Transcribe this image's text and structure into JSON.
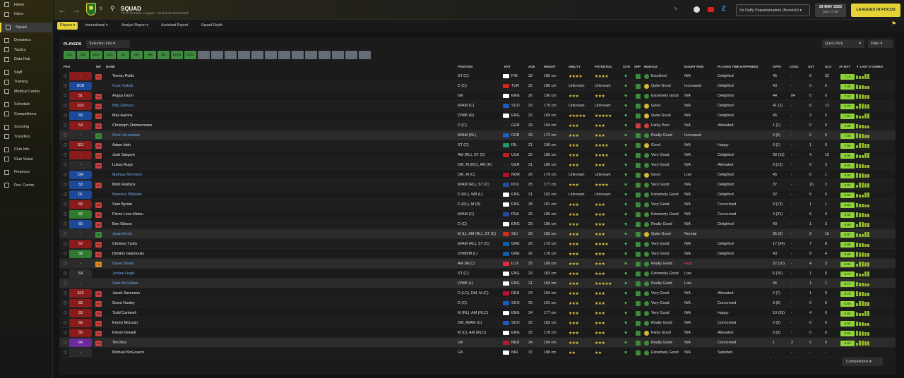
{
  "sidebar": {
    "items": [
      {
        "label": "Home",
        "icon": "home-icon"
      },
      {
        "label": "Inbox",
        "icon": "inbox-icon"
      },
      {
        "label": "Squad",
        "icon": "squad-icon"
      },
      {
        "label": "Dynamics",
        "icon": "dynamics-icon"
      },
      {
        "label": "Tactics",
        "icon": "tactics-icon"
      },
      {
        "label": "Data Hub",
        "icon": "datahub-icon"
      },
      {
        "label": "Staff",
        "icon": "staff-icon"
      },
      {
        "label": "Training",
        "icon": "training-icon"
      },
      {
        "label": "Medical Centre",
        "icon": "medical-icon"
      },
      {
        "label": "Schedule",
        "icon": "schedule-icon"
      },
      {
        "label": "Competitions",
        "icon": "trophy-icon"
      },
      {
        "label": "Scouting",
        "icon": "scouting-icon"
      },
      {
        "label": "Transfers",
        "icon": "transfers-icon"
      },
      {
        "label": "Club Info",
        "icon": "club-info-icon"
      },
      {
        "label": "Club Vision",
        "icon": "club-vision-icon"
      },
      {
        "label": "Finances",
        "icon": "finances-icon"
      },
      {
        "label": "Dev. Centre",
        "icon": "dev-centre-icon"
      }
    ]
  },
  "header": {
    "title": "SQUAD",
    "subtitle": "7th in Premier League - No fixture scheduled.",
    "manager": "Sir Daffy Papastamatinio (Norwich)",
    "date": "29 MAY 2022",
    "day": "Sun 17:00",
    "leagues_btn": "LEAGUES IN FOCUS"
  },
  "subnav": [
    "Players",
    "International",
    "Analyst Report",
    "Assistant Report",
    "Squad Depth"
  ],
  "panel": {
    "title": "PLAYERS",
    "selection_info": "Selection Info",
    "quick_pick": "Quick Pick",
    "filter": "Filter",
    "competitions": "Competitions"
  },
  "positions": [
    "GK",
    "DR",
    "DCR",
    "DCL",
    "DL",
    "DM",
    "MR",
    "ML",
    "STCR",
    "STCL",
    "",
    "",
    "",
    "",
    "",
    "",
    "",
    "",
    "",
    "",
    "",
    "",
    ""
  ],
  "columns": {
    "pkd": "PKD",
    "inf": "INF",
    "name": "NAME",
    "position": "POSITION",
    "nat": "NAT",
    "age": "AGE",
    "height": "HEIGHT",
    "ability": "ABILITY",
    "potential": "POTENTIAL",
    "con": "CON",
    "shp": "SHP",
    "morale": "MORALE",
    "injury": "INJURY RISK",
    "pt": "PLAYING TIME HAPPINESS",
    "apps": "APPS",
    "conc": "CONC",
    "ast": "AST",
    "gls": "GLS",
    "avrat": "AV RAT",
    "last5": "▼ LAST 5 GAMES"
  },
  "players": [
    {
      "pick": "-",
      "pickcolor": "#8a1b1b",
      "name": "Teemu Pukki",
      "pos": "ST (C)",
      "nat": "FIN",
      "age": "32",
      "ht": "180 cm",
      "ab": "★★★★",
      "pot": "★★★★",
      "morale": "Excellent",
      "inj": "N/A",
      "pt": "Delighted",
      "apps": "45",
      "conc": "-",
      "ast": "6",
      "gls": "32",
      "rat": "7.15",
      "inf": "Hot",
      "infc": "#c94040",
      "link": false,
      "flag": "#fff"
    },
    {
      "pick": "DCR",
      "pickcolor": "#1c4a9a",
      "name": "Ozan Kabak",
      "pos": "D (C)",
      "nat": "TUR",
      "age": "22",
      "ht": "186 cm",
      "ab": "Unknown",
      "pot": "Unknown",
      "morale": "Quite Good",
      "inj": "Increased",
      "pt": "Delighted",
      "apps": "43",
      "conc": "-",
      "ast": "0",
      "gls": "5",
      "rat": "7.08",
      "inf": "",
      "infc": "",
      "link": true,
      "flag": "#d22"
    },
    {
      "pick": "S1",
      "pickcolor": "#8a1b1b",
      "name": "Angus Gunn",
      "pos": "GK",
      "nat": "ENG",
      "age": "26",
      "ht": "196 cm",
      "ab": "★★★",
      "pot": "★★★",
      "morale": "Extremely Good",
      "inj": "N/A",
      "pt": "Delighted",
      "apps": "44",
      "conc": "84",
      "ast": "0",
      "gls": "0",
      "rat": "7.03",
      "inf": "Hot",
      "infc": "#c94040",
      "link": false,
      "flag": "#fff"
    },
    {
      "pick": "S10",
      "pickcolor": "#8a1b1b",
      "name": "Billy Gilmour",
      "pos": "M/AM (C)",
      "nat": "SCO",
      "age": "20",
      "ht": "170 cm",
      "ab": "Unknown",
      "pot": "Unknown",
      "morale": "Good",
      "inj": "N/A",
      "pt": "Delighted",
      "apps": "41 (2)",
      "conc": "-",
      "ast": "6",
      "gls": "12",
      "rat": "6.70",
      "inf": "Hot",
      "infc": "#c94040",
      "link": true,
      "flag": "#1d5bbf"
    },
    {
      "pick": "S9",
      "pickcolor": "#1c4a9a",
      "name": "Max Aarons",
      "pos": "D/WB (R)",
      "nat": "ENG",
      "age": "22",
      "ht": "169 cm",
      "ab": "★★★★★",
      "pot": "★★★★★",
      "morale": "Quite Good",
      "inj": "N/A",
      "pt": "Delighted",
      "apps": "45",
      "conc": "-",
      "ast": "3",
      "gls": "0",
      "rat": "7.01",
      "inf": "Hot",
      "infc": "#c94040",
      "link": false,
      "flag": "#fff"
    },
    {
      "pick": "S4",
      "pickcolor": "#8a1b1b",
      "name": "Christoph Zimmermann",
      "pos": "D (C)",
      "nat": "GER",
      "age": "29",
      "ht": "194 cm",
      "ab": "★★★",
      "pot": "★★★",
      "morale": "Fairly Poor",
      "inj": "N/A",
      "pt": "Alienated",
      "apps": "1 (1)",
      "conc": "-",
      "ast": "0",
      "gls": "0",
      "rat": "6.98",
      "inf": "Hot",
      "infc": "#c94040",
      "link": false,
      "flag": "#222"
    },
    {
      "pick": "-",
      "pickcolor": "#2b2b2b",
      "name": "Onel Hernández",
      "pos": "M/AM (RL)",
      "nat": "CUB",
      "age": "29",
      "ht": "172 cm",
      "ab": "★★★",
      "pot": "★★★",
      "morale": "Really Good",
      "inj": "Increased",
      "pt": "",
      "apps": "0 (5)",
      "conc": "-",
      "ast": "0",
      "gls": "0",
      "rat": "7.00",
      "inf": "Inj",
      "infc": "#3d8b3d",
      "link": true,
      "flag": "#1d5bbf"
    },
    {
      "pick": "S11",
      "pickcolor": "#8a1b1b",
      "name": "Adam Idah",
      "pos": "ST (C)",
      "nat": "IRL",
      "age": "21",
      "ht": "190 cm",
      "ab": "★★★",
      "pot": "★★★★",
      "morale": "Good",
      "inj": "N/A",
      "pt": "Happy",
      "apps": "0 (1)",
      "conc": "-",
      "ast": "1",
      "gls": "0",
      "rat": "7.00",
      "inf": "Hot",
      "infc": "#c94040",
      "link": false,
      "flag": "#169b62"
    },
    {
      "pick": "-",
      "pickcolor": "#8a1b1b",
      "name": "Josh Sargent",
      "pos": "AM (RL), ST (C)",
      "nat": "USA",
      "age": "22",
      "ht": "185 cm",
      "ab": "★★★",
      "pot": "★★★★",
      "morale": "Very Good",
      "inj": "N/A",
      "pt": "Delighted",
      "apps": "30 (11)",
      "conc": "-",
      "ast": "4",
      "gls": "19",
      "rat": "6.98",
      "inf": "Hot",
      "infc": "#c94040",
      "link": false,
      "flag": "#b22"
    },
    {
      "pick": "-",
      "pickcolor": "#2b2b2b",
      "name": "Lukas Rupp",
      "pos": "DM, M (RC), AM (R)",
      "nat": "GER",
      "age": "31",
      "ht": "180 cm",
      "ab": "★★★",
      "pot": "★★★",
      "morale": "Very Good",
      "inj": "N/A",
      "pt": "Alienated",
      "apps": "0 (13)",
      "conc": "-",
      "ast": "0",
      "gls": "3",
      "rat": "6.92",
      "inf": "Hot",
      "infc": "#c94040",
      "link": false,
      "flag": "#222"
    },
    {
      "pick": "DM",
      "pickcolor": "#1c4a9a",
      "name": "Mathias Normann",
      "pos": "DM, M (C)",
      "nat": "NOR",
      "age": "26",
      "ht": "179 cm",
      "ab": "Unknown",
      "pot": "Unknown",
      "morale": "Good",
      "inj": "Low",
      "pt": "Delighted",
      "apps": "45",
      "conc": "-",
      "ast": "6",
      "gls": "1",
      "rat": "6.92",
      "inf": "",
      "infc": "",
      "link": true,
      "flag": "#ba0c2f"
    },
    {
      "pick": "S3",
      "pickcolor": "#1c4a9a",
      "name": "Milot Rashica",
      "pos": "M/AM (RL), ST (C)",
      "nat": "KVX",
      "age": "25",
      "ht": "177 cm",
      "ab": "★★★",
      "pot": "★★★★",
      "morale": "Very Good",
      "inj": "N/A",
      "pt": "Delighted",
      "apps": "37",
      "conc": "-",
      "ast": "16",
      "gls": "2",
      "rat": "6.92",
      "inf": "Hot",
      "infc": "#c94040",
      "link": false,
      "flag": "#244aa5"
    },
    {
      "pick": "DL",
      "pickcolor": "#1c4a9a",
      "name": "Brandon Williams",
      "pos": "D (RL), WB (L)",
      "nat": "ENG",
      "age": "21",
      "ht": "182 cm",
      "ab": "Unknown",
      "pot": "Unknown",
      "morale": "Extremely Good",
      "inj": "N/A",
      "pt": "Delighted",
      "apps": "32",
      "conc": "-",
      "ast": "5",
      "gls": "0",
      "rat": "6.92",
      "inf": "",
      "infc": "",
      "link": true,
      "flag": "#fff"
    },
    {
      "pick": "S6",
      "pickcolor": "#8a1b1b",
      "name": "Sam Byram",
      "pos": "D (RL), M (R)",
      "nat": "ENG",
      "age": "28",
      "ht": "181 cm",
      "ab": "★★★",
      "pot": "★★★",
      "morale": "Very Good",
      "inj": "N/A",
      "pt": "Concerned",
      "apps": "9 (13)",
      "conc": "-",
      "ast": "1",
      "gls": "1",
      "rat": "6.91",
      "inf": "Hot",
      "infc": "#c94040",
      "link": false,
      "flag": "#fff"
    },
    {
      "pick": "S2",
      "pickcolor": "#2f7a2f",
      "name": "Pierre Lees-Melou",
      "pos": "M/AM (C)",
      "nat": "FRA",
      "age": "29",
      "ht": "185 cm",
      "ab": "★★★",
      "pot": "★★★",
      "morale": "Extremely Good",
      "inj": "N/A",
      "pt": "Concerned",
      "apps": "4 (31)",
      "conc": "-",
      "ast": "6",
      "gls": "0",
      "rat": "6.89",
      "inf": "Hot",
      "infc": "#c94040",
      "link": false,
      "flag": "#244aa5"
    },
    {
      "pick": "S5",
      "pickcolor": "#1c4a9a",
      "name": "Ben Gibson",
      "pos": "D (C)",
      "nat": "ENG",
      "age": "29",
      "ht": "186 cm",
      "ab": "★★★",
      "pot": "★★★",
      "morale": "Really Good",
      "inj": "N/A",
      "pt": "Delighted",
      "apps": "43",
      "conc": "-",
      "ast": "1",
      "gls": "3",
      "rat": "6.89",
      "inf": "Hot",
      "infc": "#c94040",
      "link": false,
      "flag": "#fff"
    },
    {
      "pick": "-",
      "pickcolor": "#2b2b2b",
      "name": "Josip Drmić",
      "pos": "M (L), AM (RL), ST (C)",
      "nat": "SUI",
      "age": "29",
      "ht": "183 cm",
      "ab": "★★★",
      "pot": "★★★",
      "morale": "Quite Good",
      "inj": "Normal",
      "pt": "",
      "apps": "35 (3)",
      "conc": "-",
      "ast": "2",
      "gls": "15",
      "rat": "6.87",
      "inf": "Inj",
      "infc": "#3d8b3d",
      "link": true,
      "flag": "#d52b1e"
    },
    {
      "pick": "S7",
      "pickcolor": "#8a1b1b",
      "name": "Christos Tzolis",
      "pos": "M/AM (RL), ST (C)",
      "nat": "GRE",
      "age": "20",
      "ht": "170 cm",
      "ab": "★★★",
      "pot": "★★★★",
      "morale": "Very Good",
      "inj": "N/A",
      "pt": "Delighted",
      "apps": "17 (24)",
      "conc": "-",
      "ast": "7",
      "gls": "8",
      "rat": "6.86",
      "inf": "Hot",
      "infc": "#c94040",
      "link": false,
      "flag": "#0d5eaf"
    },
    {
      "pick": "S8",
      "pickcolor": "#2f7a2f",
      "name": "Dimitris Giannoulis",
      "pos": "D/WB/M (L)",
      "nat": "GRE",
      "age": "26",
      "ht": "178 cm",
      "ab": "★★★",
      "pot": "★★★",
      "morale": "Very Good",
      "inj": "N/A",
      "pt": "Delighted",
      "apps": "43",
      "conc": "-",
      "ast": "8",
      "gls": "4",
      "rat": "6.86",
      "inf": "Hot",
      "infc": "#c94040",
      "link": false,
      "flag": "#0d5eaf"
    },
    {
      "pick": "-",
      "pickcolor": "#2b2b2b",
      "name": "Danel Sinani",
      "pos": "AM (RLC)",
      "nat": "LUX",
      "age": "25",
      "ht": "189 cm",
      "ab": "★★★",
      "pot": "★★★",
      "morale": "Really Good",
      "inj": "High",
      "pt": "",
      "apps": "22 (10)",
      "conc": "-",
      "ast": "4",
      "gls": "3",
      "rat": "6.86",
      "inf": "Inj",
      "infc": "#e08a2a",
      "link": true,
      "flag": "#ed2939"
    },
    {
      "pick": "S4",
      "pickcolor": "#2b2b2b",
      "name": "Jordan Hugill",
      "pos": "ST (C)",
      "nat": "ENG",
      "age": "29",
      "ht": "183 cm",
      "ab": "★★★",
      "pot": "★★★",
      "morale": "Extremely Good",
      "inj": "Low",
      "pt": "",
      "apps": "6 (26)",
      "conc": "-",
      "ast": "1",
      "gls": "6",
      "rat": "6.77",
      "inf": "",
      "infc": "",
      "link": true,
      "flag": "#fff"
    },
    {
      "pick": "-",
      "pickcolor": "#2b2b2b",
      "name": "Sam McCallum",
      "pos": "D/WB (L)",
      "nat": "ENG",
      "age": "21",
      "ht": "184 cm",
      "ab": "★★★",
      "pot": "★★★★★",
      "morale": "Really Good",
      "inj": "Low",
      "pt": "",
      "apps": "46",
      "conc": "-",
      "ast": "1",
      "gls": "1",
      "rat": "6.77",
      "inf": "",
      "infc": "",
      "link": true,
      "flag": "#fff"
    },
    {
      "pick": "S10",
      "pickcolor": "#8a1b1b",
      "name": "Jacob Sørensen",
      "pos": "D (LC), DM, M (C)",
      "nat": "DEN",
      "age": "24",
      "ht": "184 cm",
      "ab": "★★★",
      "pot": "★★★",
      "morale": "Very Good",
      "inj": "N/A",
      "pt": "Alienated",
      "apps": "2 (7)",
      "conc": "-",
      "ast": "1",
      "gls": "0",
      "rat": "6.76",
      "inf": "Hot",
      "infc": "#c94040",
      "link": false,
      "flag": "#c60c30"
    },
    {
      "pick": "S2",
      "pickcolor": "#8a1b1b",
      "name": "Grant Hanley",
      "pos": "D (C)",
      "nat": "SCO",
      "age": "30",
      "ht": "191 cm",
      "ab": "★★★",
      "pot": "★★★",
      "morale": "Very Good",
      "inj": "N/A",
      "pt": "Concerned",
      "apps": "3 (6)",
      "conc": "-",
      "ast": "0",
      "gls": "0",
      "rat": "6.66",
      "inf": "Hot",
      "infc": "#c94040",
      "link": false,
      "flag": "#1d5bbf"
    },
    {
      "pick": "S3",
      "pickcolor": "#8a1b1b",
      "name": "Todd Cantwell",
      "pos": "M (RL), AM (RLC)",
      "nat": "ENG",
      "age": "24",
      "ht": "177 cm",
      "ab": "★★★",
      "pot": "★★★",
      "morale": "Very Good",
      "inj": "N/A",
      "pt": "Happy",
      "apps": "10 (25)",
      "conc": "-",
      "ast": "4",
      "gls": "0",
      "rat": "6.56",
      "inf": "Hot",
      "infc": "#c94040",
      "link": false,
      "flag": "#fff"
    },
    {
      "pick": "S6",
      "pickcolor": "#8a1b1b",
      "name": "Kenny McLean",
      "pos": "DM, M/AM (C)",
      "nat": "SCO",
      "age": "30",
      "ht": "183 cm",
      "ab": "★★★",
      "pot": "★★★",
      "morale": "Really Good",
      "inj": "N/A",
      "pt": "Concerned",
      "apps": "0 (3)",
      "conc": "-",
      "ast": "0",
      "gls": "0",
      "rat": "6.50",
      "inf": "Hot",
      "infc": "#c94040",
      "link": false,
      "flag": "#1d5bbf"
    },
    {
      "pick": "S5",
      "pickcolor": "#8a1b1b",
      "name": "Kieran Dowell",
      "pos": "M (C), AM (RLC)",
      "nat": "ENG",
      "age": "25",
      "ht": "178 cm",
      "ab": "★★★",
      "pot": "★★★",
      "morale": "Fairly Good",
      "inj": "N/A",
      "pt": "Alienated",
      "apps": "0 (3)",
      "conc": "-",
      "ast": "0",
      "gls": "0",
      "rat": "6.50",
      "inf": "Hot",
      "infc": "#c94040",
      "link": false,
      "flag": "#fff"
    },
    {
      "pick": "GK",
      "pickcolor": "#6b2a9a",
      "name": "Tim Krul",
      "pos": "GK",
      "nat": "NED",
      "age": "34",
      "ht": "194 cm",
      "ab": "★★★",
      "pot": "★★★",
      "morale": "Really Good",
      "inj": "N/A",
      "pt": "Concerned",
      "apps": "1",
      "conc": "2",
      "ast": "0",
      "gls": "0",
      "rat": "6.50",
      "inf": "Hot",
      "infc": "#c94040",
      "link": false,
      "flag": "#ae1c28"
    },
    {
      "pick": "-",
      "pickcolor": "#2b2b2b",
      "name": "Michael McGovern",
      "pos": "GK",
      "nat": "NIR",
      "age": "37",
      "ht": "188 cm",
      "ab": "★★",
      "pot": "★★",
      "morale": "Extremely Good",
      "inj": "N/A",
      "pt": "Satisfied",
      "apps": "-",
      "conc": "-",
      "ast": "-",
      "gls": "-",
      "rat": "",
      "inf": "",
      "infc": "",
      "link": false,
      "flag": "#fff"
    }
  ],
  "colors": {
    "accent": "#e5d237",
    "good": "#3d8b3d",
    "hot": "#c94040"
  }
}
